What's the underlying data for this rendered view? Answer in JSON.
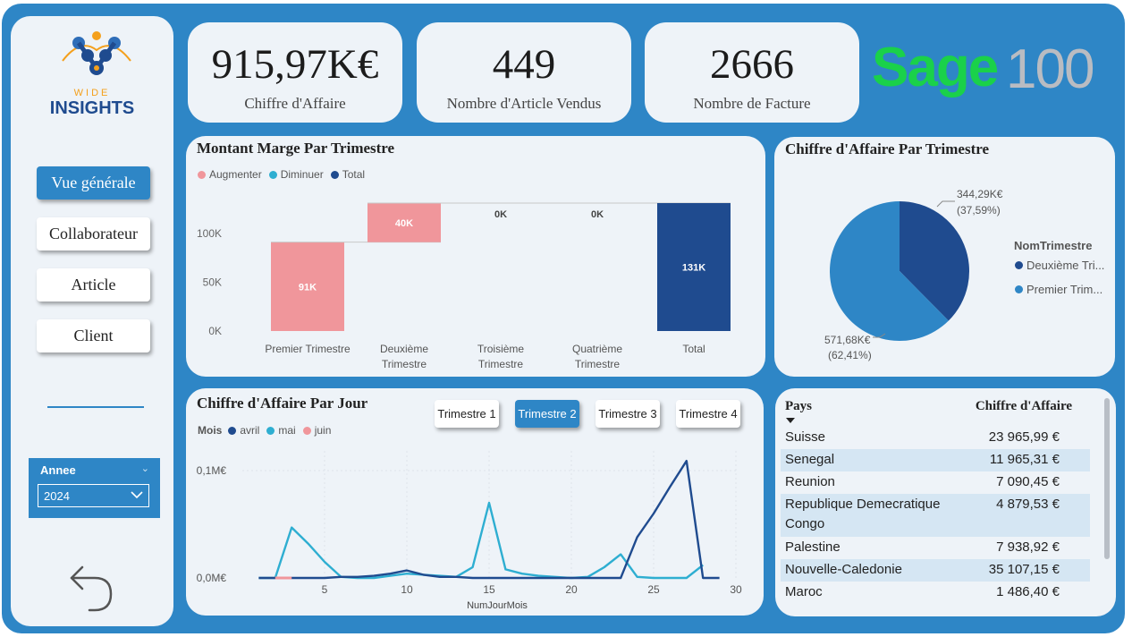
{
  "brand": {
    "logo_top": "WIDE",
    "logo_bottom": "INSIGHTS",
    "sage_word": "Sage",
    "sage_num": "100"
  },
  "nav": [
    {
      "label": "Vue générale",
      "active": true
    },
    {
      "label": "Collaborateur",
      "active": false
    },
    {
      "label": "Article",
      "active": false
    },
    {
      "label": "Client",
      "active": false
    }
  ],
  "slicer": {
    "title": "Annee",
    "value": "2024"
  },
  "kpis": [
    {
      "value": "915,97K€",
      "label": "Chiffre d'Affaire"
    },
    {
      "value": "449",
      "label": "Nombre d'Article Vendus"
    },
    {
      "value": "2666",
      "label": "Nombre de Facture"
    }
  ],
  "waterfall": {
    "title": "Montant Marge Par Trimestre",
    "legend": [
      {
        "label": "Augmenter",
        "color": "#f0969b"
      },
      {
        "label": "Diminuer",
        "color": "#2eaed1"
      },
      {
        "label": "Total",
        "color": "#1f4b8f"
      }
    ]
  },
  "pie": {
    "title": "Chiffre d'Affaire Par Trimestre",
    "legend_title": "NomTrimestre",
    "legend_items": [
      {
        "label": "Deuxième Tri...",
        "color": "#1f4b8f"
      },
      {
        "label": "Premier Trim...",
        "color": "#2e86c6"
      }
    ]
  },
  "daily": {
    "title": "Chiffre d'Affaire Par Jour",
    "legend_title": "Mois",
    "legend": [
      {
        "label": "avril",
        "color": "#1f4b8f"
      },
      {
        "label": "mai",
        "color": "#2eaed1"
      },
      {
        "label": "juin",
        "color": "#f0969b"
      }
    ],
    "buttons": [
      {
        "label": "Trimestre 1",
        "active": false
      },
      {
        "label": "Trimestre 2",
        "active": true
      },
      {
        "label": "Trimestre 3",
        "active": false
      },
      {
        "label": "Trimestre 4",
        "active": false
      }
    ]
  },
  "table": {
    "headers": [
      "Pays",
      "Chiffre d'Affaire"
    ],
    "rows": [
      [
        "Suisse",
        "23 965,99 €"
      ],
      [
        "Senegal",
        "11 965,31 €"
      ],
      [
        "Reunion",
        "7 090,45 €"
      ],
      [
        "Republique Demecratique Congo",
        "4 879,53 €"
      ],
      [
        "Palestine",
        "7 938,92 €"
      ],
      [
        "Nouvelle-Caledonie",
        "35 107,15 €"
      ],
      [
        "Maroc",
        "1 486,40 €"
      ]
    ]
  },
  "chart_data": [
    {
      "type": "bar",
      "title": "Montant Marge Par Trimestre",
      "subtype": "waterfall",
      "categories": [
        "Premier Trimestre",
        "Deuxième Trimestre",
        "Troisième Trimestre",
        "Quatrième Trimestre",
        "Total"
      ],
      "values": [
        91,
        40,
        0,
        0,
        131
      ],
      "data_labels": [
        "91K",
        "40K",
        "0K",
        "0K",
        "131K"
      ],
      "yticks": [
        "0K",
        "50K",
        "100K"
      ],
      "ylim": [
        0,
        131
      ],
      "legend": [
        "Augmenter",
        "Diminuer",
        "Total"
      ]
    },
    {
      "type": "pie",
      "title": "Chiffre d'Affaire Par Trimestre",
      "legend_title": "NomTrimestre",
      "slices": [
        {
          "name": "Deuxième Tri...",
          "value": 344.29,
          "label": "344,29K€",
          "pct": "(37,59%)",
          "color": "#1f4b8f"
        },
        {
          "name": "Premier Trim...",
          "value": 571.68,
          "label": "571,68K€",
          "pct": "(62,41%)",
          "color": "#2e86c6"
        }
      ]
    },
    {
      "type": "line",
      "title": "Chiffre d'Affaire Par Jour",
      "xlabel": "NumJourMois",
      "xticks": [
        "5",
        "10",
        "15",
        "20",
        "25",
        "30"
      ],
      "yticks": [
        "0,0M€",
        "0,1M€"
      ],
      "xlim": [
        0,
        30
      ],
      "ylim": [
        0,
        0.11
      ],
      "series": [
        {
          "name": "avril",
          "color": "#1f4b8f",
          "x": [
            1,
            2,
            3,
            4,
            5,
            6,
            7,
            8,
            9,
            10,
            11,
            12,
            13,
            14,
            15,
            16,
            17,
            18,
            19,
            20,
            21,
            22,
            23,
            24,
            25,
            26,
            27,
            28,
            29
          ],
          "y": [
            0,
            0,
            0,
            0,
            0,
            0.001,
            0.001,
            0.002,
            0.004,
            0.007,
            0.003,
            0.001,
            0.001,
            0,
            0,
            0,
            0,
            0,
            0,
            0,
            0,
            0,
            0,
            0.038,
            0.06,
            0.085,
            0.109,
            0,
            0
          ]
        },
        {
          "name": "mai",
          "color": "#2eaed1",
          "x": [
            1,
            2,
            3,
            4,
            5,
            6,
            7,
            8,
            9,
            10,
            11,
            12,
            13,
            14,
            15,
            16,
            17,
            18,
            19,
            20,
            21,
            22,
            23,
            24,
            25,
            26,
            27,
            28
          ],
          "y": [
            0,
            0,
            0.047,
            0.032,
            0.015,
            0.001,
            0,
            0,
            0.002,
            0.004,
            0.003,
            0.002,
            0.001,
            0.01,
            0.07,
            0.008,
            0.004,
            0.002,
            0.001,
            0,
            0.001,
            0.01,
            0.022,
            0.001,
            0,
            0,
            0,
            0.012
          ]
        },
        {
          "name": "juin",
          "color": "#f0969b",
          "x": [
            2,
            3
          ],
          "y": [
            0,
            0
          ]
        }
      ]
    }
  ]
}
